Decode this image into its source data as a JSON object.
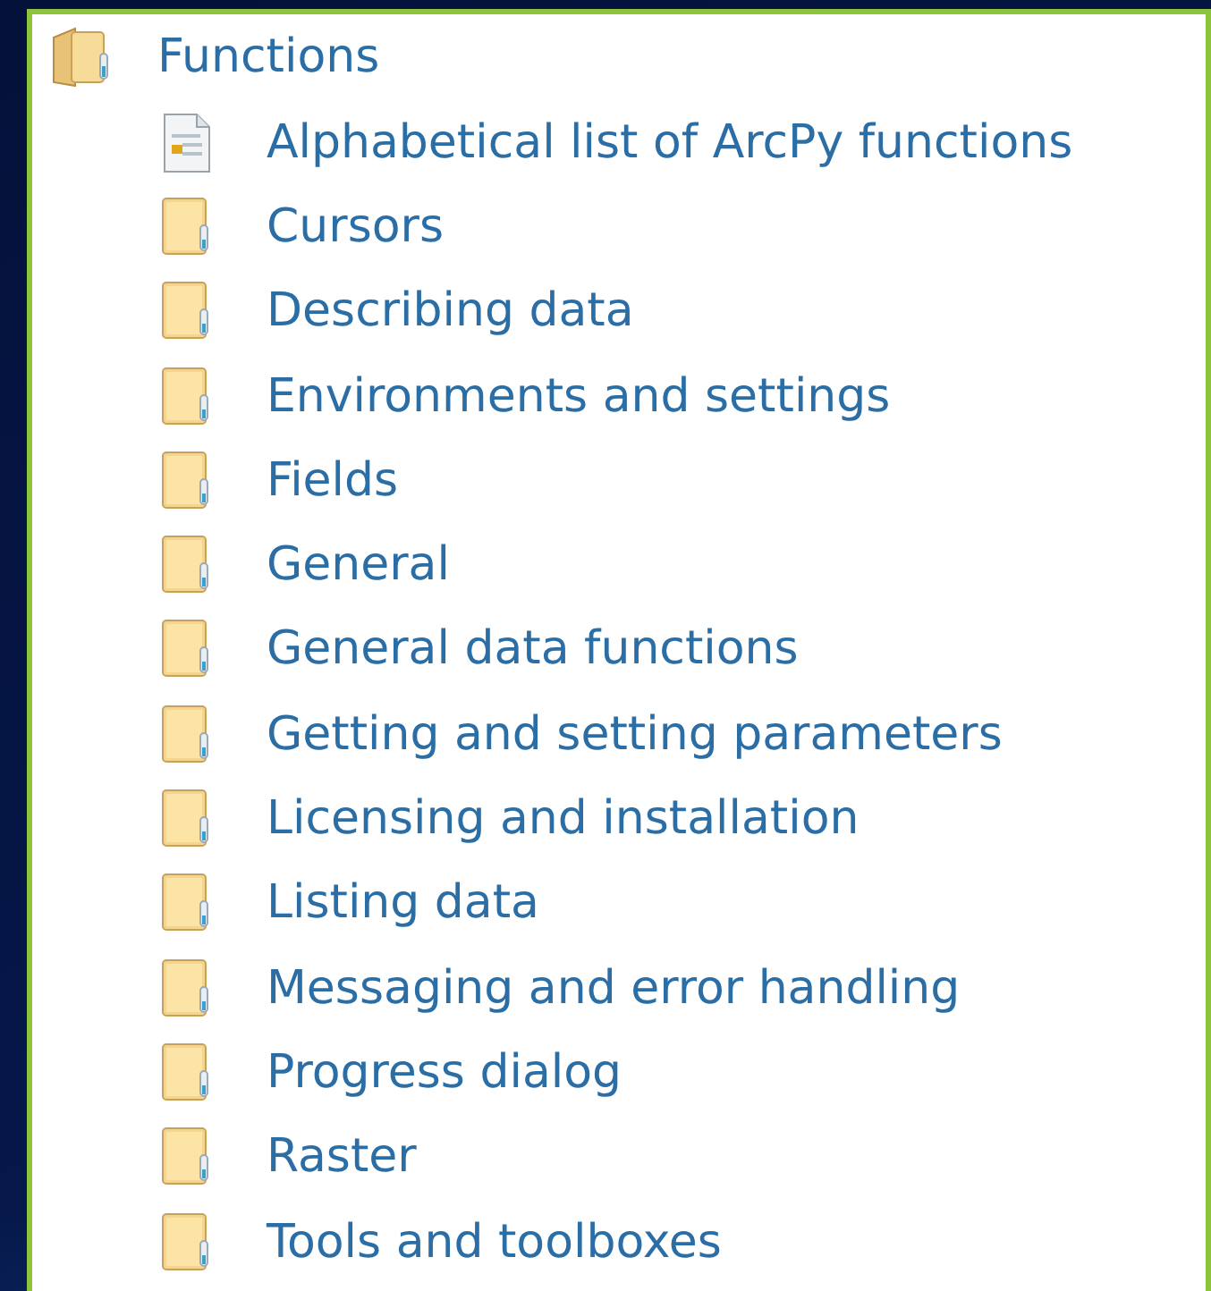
{
  "tree": {
    "label": "Functions",
    "kind": "folder-open",
    "children": [
      {
        "label": "Alphabetical list of ArcPy functions",
        "kind": "document"
      },
      {
        "label": "Cursors",
        "kind": "folder"
      },
      {
        "label": "Describing data",
        "kind": "folder"
      },
      {
        "label": "Environments and settings",
        "kind": "folder"
      },
      {
        "label": "Fields",
        "kind": "folder"
      },
      {
        "label": "General",
        "kind": "folder"
      },
      {
        "label": "General data functions",
        "kind": "folder"
      },
      {
        "label": "Getting and setting parameters",
        "kind": "folder"
      },
      {
        "label": "Licensing and installation",
        "kind": "folder"
      },
      {
        "label": "Listing data",
        "kind": "folder"
      },
      {
        "label": "Messaging and error handling",
        "kind": "folder"
      },
      {
        "label": "Progress dialog",
        "kind": "folder"
      },
      {
        "label": "Raster",
        "kind": "folder"
      },
      {
        "label": "Tools and toolboxes",
        "kind": "folder"
      }
    ]
  }
}
